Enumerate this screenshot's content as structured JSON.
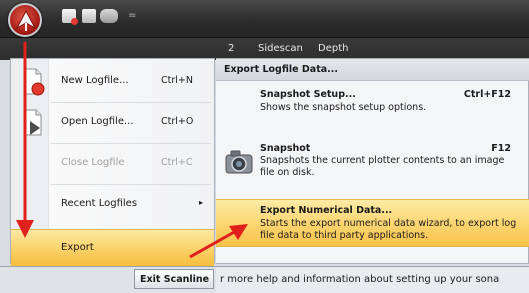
{
  "ribbon": {
    "tabs": [
      "2",
      "Sidescan",
      "Depth"
    ],
    "quick_access_dropdown": "="
  },
  "app_menu": {
    "items": [
      {
        "label": "New Logfile...",
        "shortcut": "Ctrl+N",
        "icon": "new-logfile-icon",
        "enabled": true
      },
      {
        "label": "Open Logfile...",
        "shortcut": "Ctrl+O",
        "icon": "open-logfile-icon",
        "enabled": true
      },
      {
        "label": "Close Logfile",
        "shortcut": "Ctrl+C",
        "icon": "",
        "enabled": false
      },
      {
        "label": "Recent Logfiles",
        "shortcut": "",
        "submenu_arrow": "▸",
        "enabled": true
      },
      {
        "label": "Export",
        "shortcut": "",
        "enabled": true,
        "highlighted": true
      }
    ]
  },
  "submenu": {
    "header": "Export Logfile Data...",
    "items": [
      {
        "title": "Snapshot Setup...",
        "shortcut": "Ctrl+F12",
        "description": "Shows the snapshot setup options."
      },
      {
        "title": "Snapshot",
        "shortcut": "F12",
        "description": "Snapshots the current plotter contents to an image file on disk.",
        "icon": "camera-icon"
      },
      {
        "title": "Export Numerical Data...",
        "shortcut": "",
        "description": "Starts the export numerical data wizard, to export log file data to third party applications.",
        "highlighted": true
      }
    ]
  },
  "status": {
    "exit_button": "Exit Scanline",
    "help_text": "r more help and information about setting up your sona"
  },
  "colors": {
    "highlight": "#fbd168",
    "annotation_arrow": "#e0201b",
    "app_button": "#a41a14"
  }
}
